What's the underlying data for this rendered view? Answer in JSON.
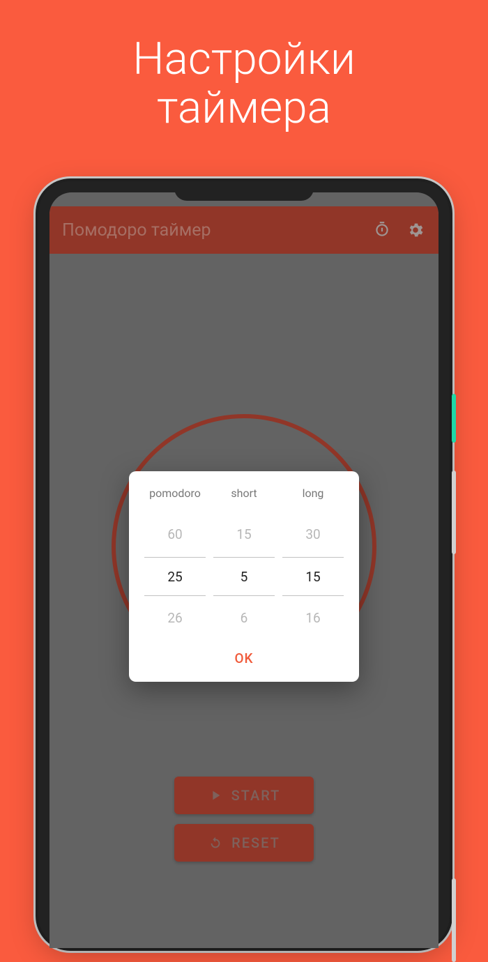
{
  "promo": {
    "line1": "Настройки",
    "line2": "таймера"
  },
  "appbar": {
    "title": "Помодоро таймер"
  },
  "buttons": {
    "start": "START",
    "reset": "RESET"
  },
  "dialog": {
    "columns": [
      {
        "label": "pomodoro",
        "prev": "60",
        "selected": "25",
        "next": "26"
      },
      {
        "label": "short",
        "prev": "15",
        "selected": "5",
        "next": "6"
      },
      {
        "label": "long",
        "prev": "30",
        "selected": "15",
        "next": "16"
      }
    ],
    "ok_label": "OK"
  },
  "colors": {
    "accent": "#fa5b3e",
    "brand": "#b64432"
  }
}
